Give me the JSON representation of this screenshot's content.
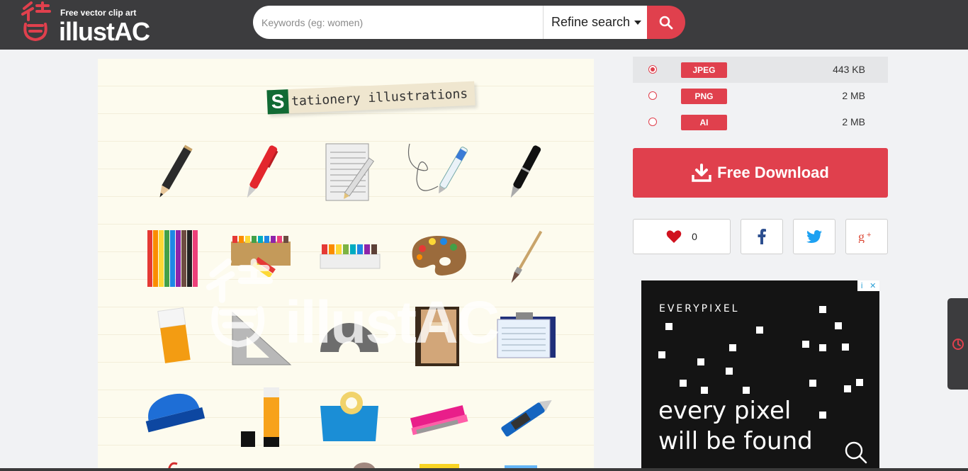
{
  "header": {
    "logo_tagline": "Free vector clip art",
    "logo_name": "illustAC",
    "search": {
      "placeholder": "Keywords (eg: women)",
      "refine_label": "Refine search"
    }
  },
  "preview": {
    "title_initial": "S",
    "title_rest": "tationery illustrations",
    "watermark_text": "illustAC",
    "items": [
      "pencil",
      "red-pen",
      "notebook",
      "ballpoint-pen",
      "fountain-pen",
      "colored-pencils",
      "crayons",
      "paints",
      "palette",
      "paintbrush",
      "eraser",
      "set-square",
      "protractor",
      "book",
      "clipboard",
      "hole-punch",
      "glue-stick",
      "tape-dispenser",
      "stapler",
      "cutter"
    ]
  },
  "formats": [
    {
      "type": "JPEG",
      "size": "443 KB",
      "selected": true
    },
    {
      "type": "PNG",
      "size": "2 MB",
      "selected": false
    },
    {
      "type": "AI",
      "size": "2 MB",
      "selected": false
    }
  ],
  "download": {
    "label": "Free Download"
  },
  "social": {
    "like_count": "0"
  },
  "ad": {
    "brand": "EVERYPIXEL",
    "line1": "every pixel",
    "line2": "will be found",
    "choices_info": "i",
    "choices_close": "✕"
  },
  "colors": {
    "header_bg": "#3c3c3e",
    "accent": "#e0404d",
    "page_bg": "#f1f2f4",
    "facebook": "#3b5998",
    "twitter": "#1da1f2",
    "google_plus": "#dd4b39"
  }
}
